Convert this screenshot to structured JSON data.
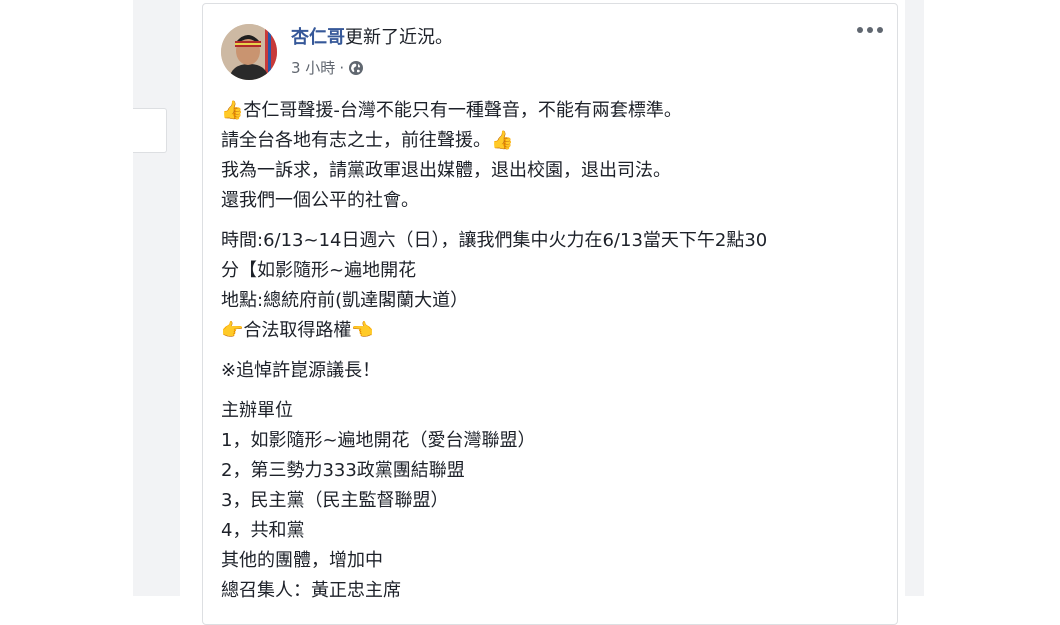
{
  "post": {
    "author_name": "杏仁哥",
    "action_text": "更新了近況。",
    "timestamp": "3 小時",
    "meta_separator": "·",
    "privacy_icon": "globe-icon",
    "menu_icon": "more-options-icon",
    "paragraphs": [
      [
        "👍杏仁哥聲援-台灣不能只有一種聲音，不能有兩套標準。",
        "請全台各地有志之士，前往聲援。👍",
        "我為一訴求，請黨政軍退出媒體，退出校園，退出司法。",
        "還我們一個公平的社會。"
      ],
      [
        "時間:6/13~14日週六（日），讓我們集中火力在6/13當天下午2點30",
        "分【如影隨形~遍地開花",
        "地點:總統府前(凱達閣蘭大道）",
        "👉合法取得路權👈"
      ],
      [
        "※追悼許崑源議長！"
      ],
      [
        "主辦單位",
        "1，如影隨形~遍地開花（愛台灣聯盟）",
        "2，第三勢力333政黨團結聯盟",
        "3，民主黨（民主監督聯盟）",
        "4，共和黨",
        "其他的團體，增加中",
        "總召集人：黃正忠主席"
      ]
    ]
  },
  "colors": {
    "link": "#365899",
    "text": "#1d2129",
    "meta": "#616770",
    "page_bg": "#f2f3f5",
    "card_border": "#dddfe2"
  }
}
